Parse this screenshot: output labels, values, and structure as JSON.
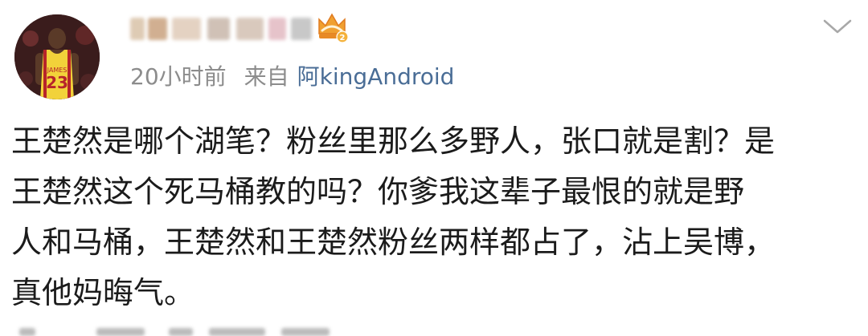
{
  "post": {
    "avatar_icon": "avatar-basketball-player",
    "jersey_number": "23",
    "crown_badge_icon": "crown-level-icon",
    "crown_level": "2",
    "time": "20小时前",
    "from_label": "来自",
    "source": "阿kingAndroid",
    "menu_icon": "chevron-down-icon",
    "content_lines": [
      "王楚然是哪个湖笔？粉丝里那么多野人，张口就是割？是",
      "王楚然这个死马桶教的吗？你爹我这辈子最恨的就是野",
      "人和马桶，王楚然和王楚然粉丝两样都占了，沾上吴博，",
      "真他妈晦气。"
    ]
  },
  "colors": {
    "meta_gray": "#8c8c8c",
    "source_blue": "#4a6d96",
    "crown_orange": "#f0a030",
    "text": "#1b1b1b"
  }
}
